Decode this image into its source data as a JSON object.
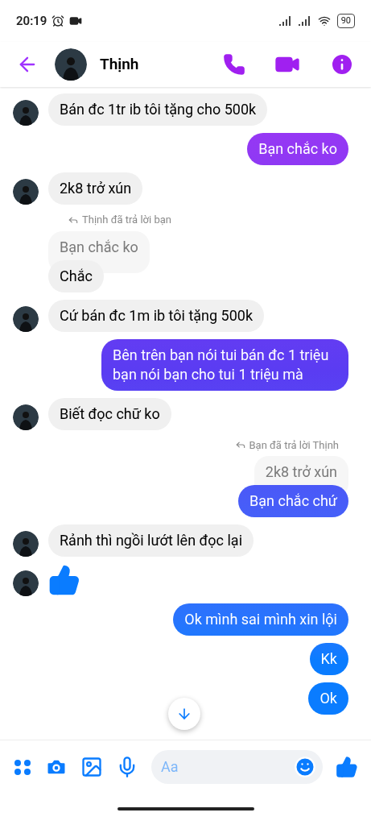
{
  "status_bar": {
    "time": "20:19",
    "battery": "90"
  },
  "header": {
    "name": "Thịnh"
  },
  "messages": [
    {
      "kind": "incoming",
      "text": "Bán đc 1tr ib tôi tặng cho 500k",
      "avatar": true
    },
    {
      "kind": "outgoing",
      "text": "Bạn chắc ko"
    },
    {
      "kind": "incoming",
      "text": "2k8 trở xún",
      "avatar": true
    },
    {
      "kind": "incoming_reply",
      "note": "Thịnh đã trả lời bạn",
      "quote": "Bạn chắc ko",
      "text": "Chắc",
      "avatar": false
    },
    {
      "kind": "incoming",
      "text": "Cứ bán đc 1m ib tôi tặng 500k",
      "avatar": true
    },
    {
      "kind": "outgoing",
      "text": "Bên trên bạn nói tui bán đc 1 triệu bạn nói bạn cho tui 1 triệu mà"
    },
    {
      "kind": "incoming",
      "text": "Biết đọc chữ ko",
      "avatar": true
    },
    {
      "kind": "outgoing_reply",
      "note": "Bạn đã trả lời Thịnh",
      "quote": "2k8 trở xún",
      "text": "Bạn chắc chứ"
    },
    {
      "kind": "incoming",
      "text": "Rảnh thì ngồi lướt lên đọc lại",
      "avatar": true
    },
    {
      "kind": "like",
      "avatar": true
    },
    {
      "kind": "outgoing",
      "text": "Ok mình sai mình xin lội"
    },
    {
      "kind": "outgoing",
      "text": "Kk"
    },
    {
      "kind": "outgoing",
      "text": "Ok"
    }
  ],
  "composer": {
    "placeholder": "Aa"
  }
}
